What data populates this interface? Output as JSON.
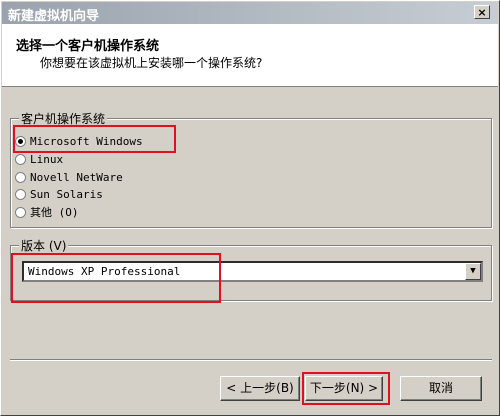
{
  "window": {
    "title": "新建虚拟机向导"
  },
  "header": {
    "title": "选择一个客户机操作系统",
    "subtitle": "你想要在该虚拟机上安装哪一个操作系统?"
  },
  "os_group": {
    "label": "客户机操作系统",
    "options": [
      {
        "label": "Microsoft Windows",
        "selected": true
      },
      {
        "label": "Linux",
        "selected": false
      },
      {
        "label": "Novell NetWare",
        "selected": false
      },
      {
        "label": "Sun Solaris",
        "selected": false
      },
      {
        "label": "其他 (O)",
        "selected": false
      }
    ]
  },
  "version_group": {
    "label": "版本 (V)",
    "selected": "Windows XP Professional"
  },
  "buttons": {
    "back": "< 上一步(B)",
    "next": "下一步(N) >",
    "cancel": "取消"
  },
  "colors": {
    "highlight": "#e01020",
    "face": "#d4d0c8"
  }
}
